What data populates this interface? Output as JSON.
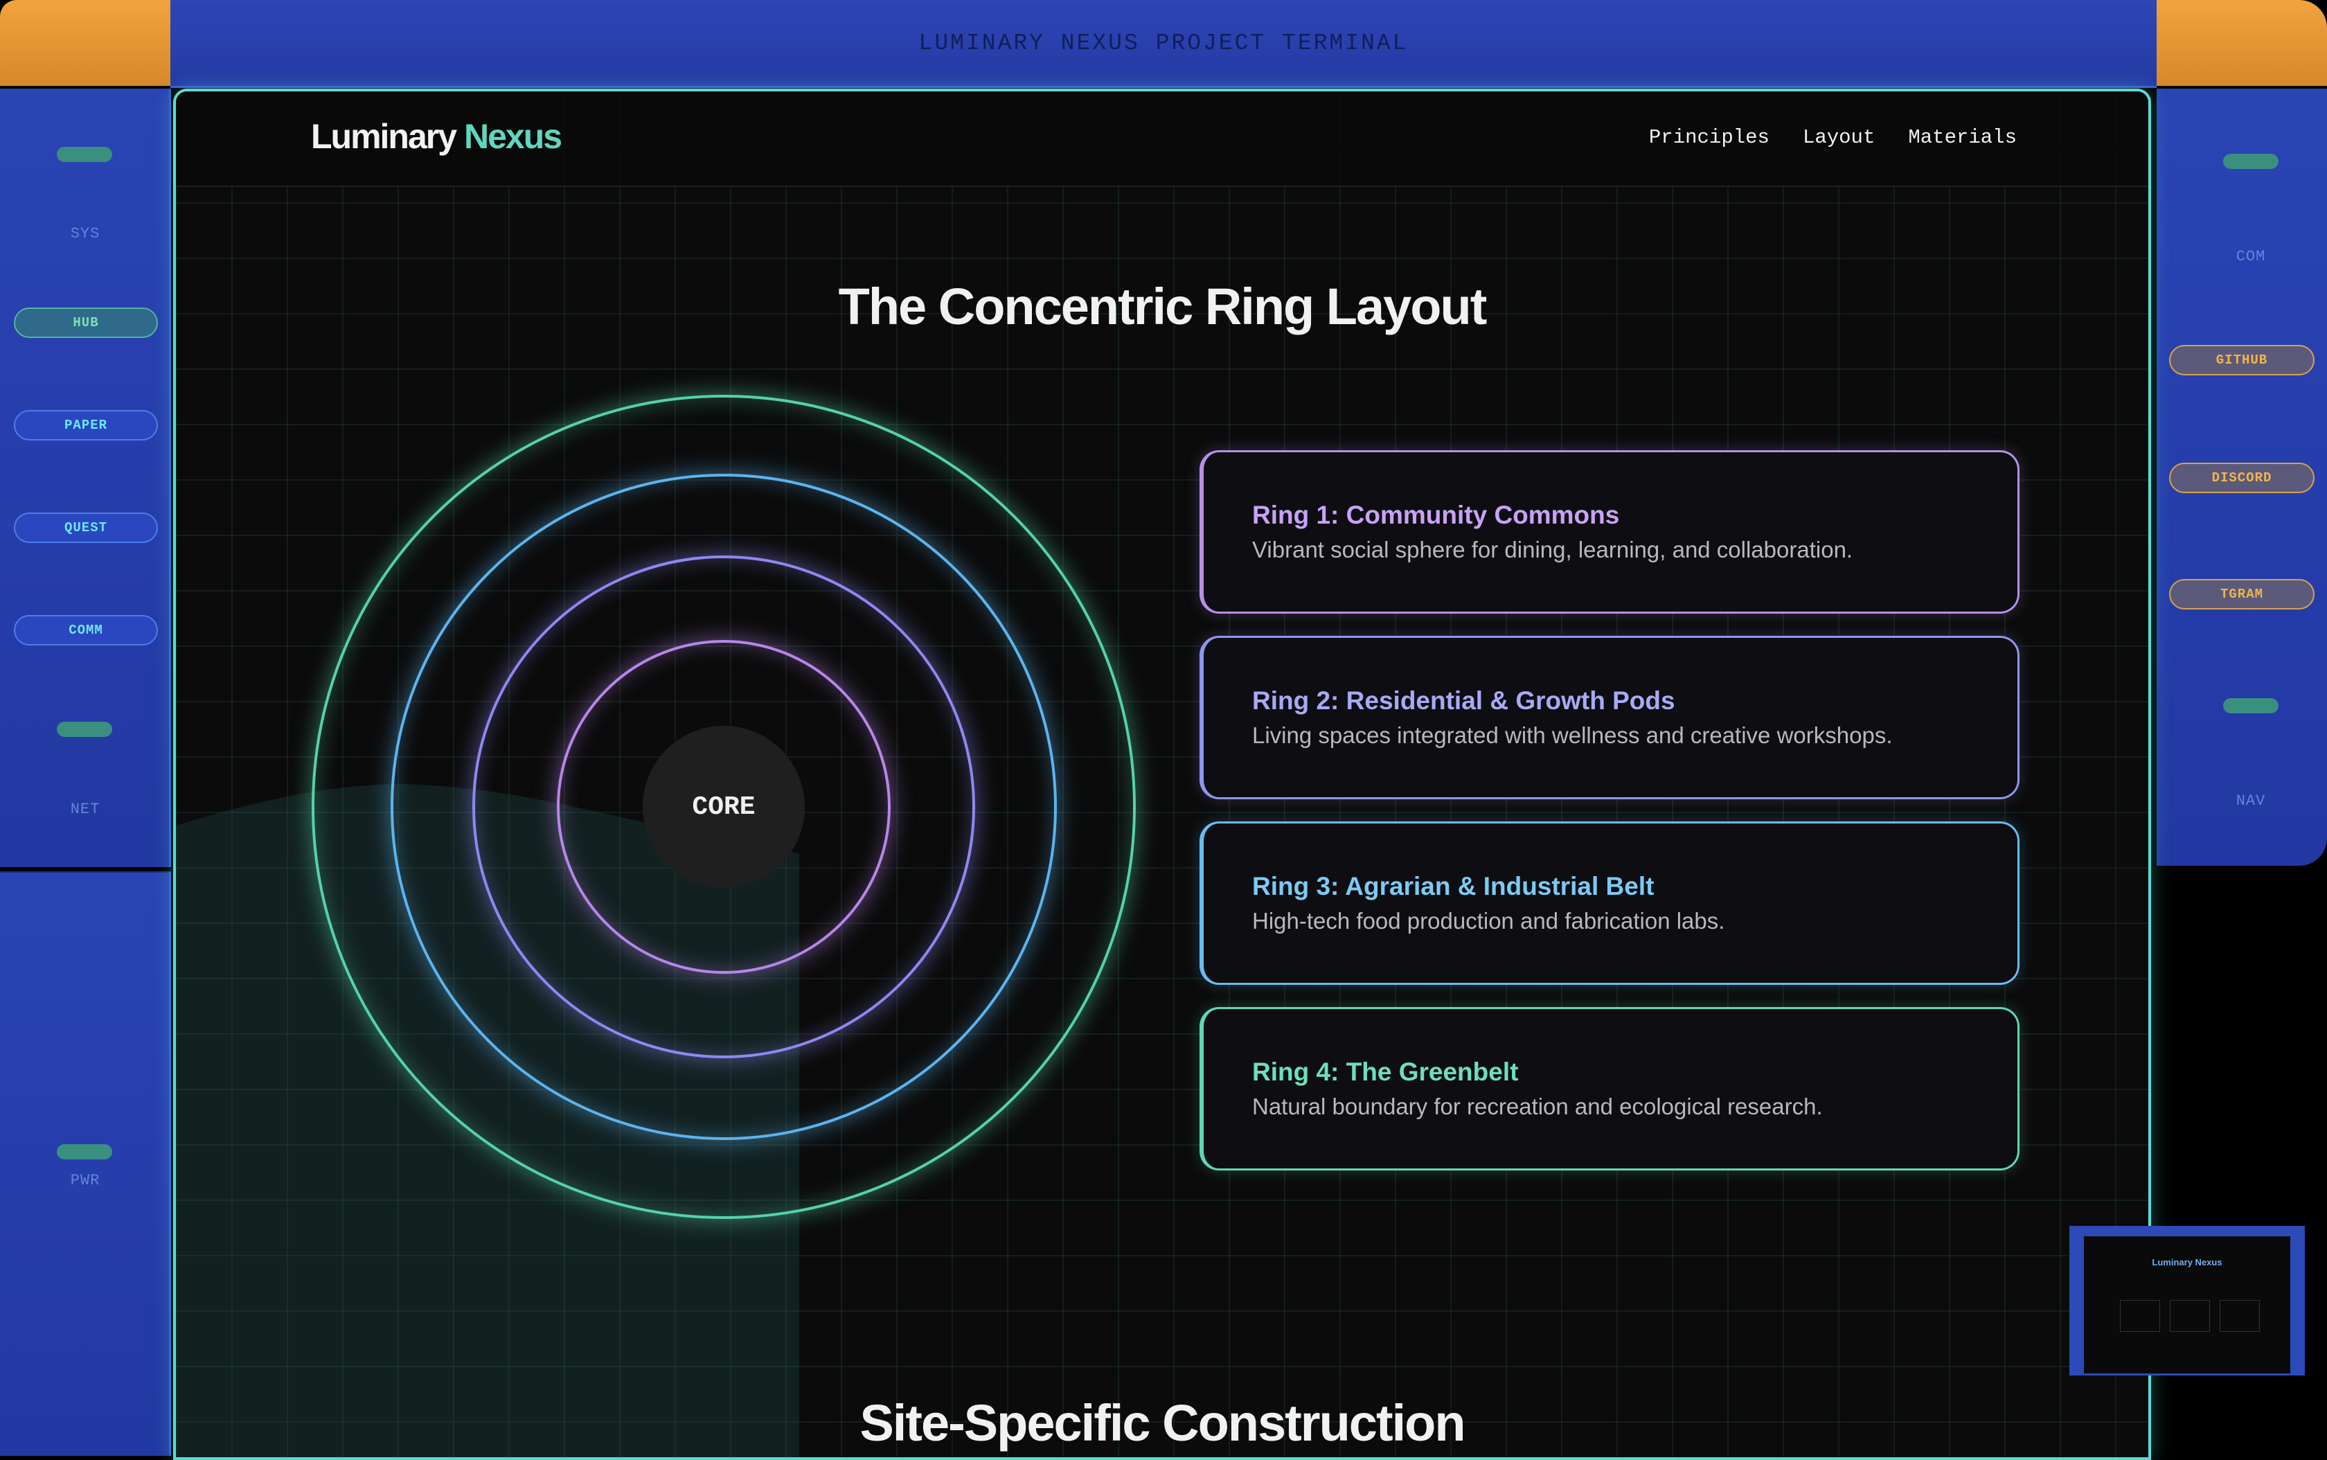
{
  "frame": {
    "title": "LUMINARY NEXUS PROJECT TERMINAL",
    "left_rail": {
      "labels": [
        "SYS",
        "NET",
        "PWR"
      ],
      "buttons": [
        "HUB",
        "PAPER",
        "QUEST",
        "COMM"
      ]
    },
    "right_rail": {
      "labels": [
        "COM",
        "NAV"
      ],
      "buttons": [
        "GITHUB",
        "DISCORD",
        "TGRAM"
      ]
    }
  },
  "nav": {
    "brand": "Luminary",
    "brand_accent": "Nexus",
    "links": [
      "Principles",
      "Layout",
      "Materials"
    ]
  },
  "layout_section": {
    "title": "The Concentric Ring Layout",
    "core_label": "CORE",
    "rings": [
      {
        "title": "Ring 1: Community Commons",
        "desc": "Vibrant social sphere for dining, learning, and collaboration.",
        "color": "#c08ff0"
      },
      {
        "title": "Ring 2: Residential & Growth Pods",
        "desc": "Living spaces integrated with wellness and creative workshops.",
        "color": "#9a9cf5"
      },
      {
        "title": "Ring 3: Agrarian & Industrial Belt",
        "desc": "High-tech food production and fabrication labs.",
        "color": "#73c5f2"
      },
      {
        "title": "Ring 4: The Greenbelt",
        "desc": "Natural boundary for recreation and ecological research.",
        "color": "#6de0b8"
      }
    ]
  },
  "next_section": {
    "title": "Site-Specific Construction"
  },
  "preview": {
    "brand": "Luminary Nexus"
  }
}
